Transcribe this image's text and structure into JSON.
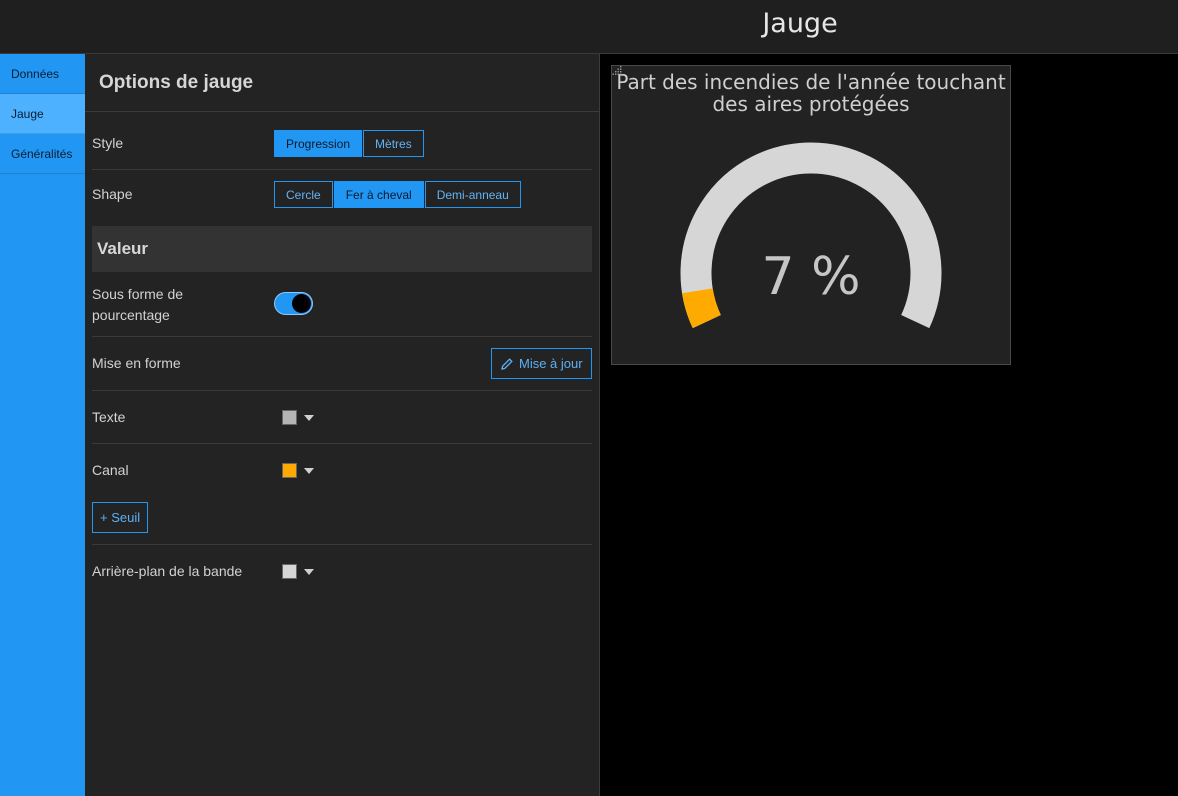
{
  "header": {
    "title": "Jauge"
  },
  "nav": {
    "items": [
      {
        "label": "Données",
        "active": false
      },
      {
        "label": "Jauge",
        "active": true
      },
      {
        "label": "Généralités",
        "active": false
      }
    ]
  },
  "panel": {
    "title": "Options de jauge",
    "style": {
      "label": "Style",
      "options": [
        "Progression",
        "Mètres"
      ],
      "selected": "Progression"
    },
    "shape": {
      "label": "Shape",
      "options": [
        "Cercle",
        "Fer à cheval",
        "Demi-anneau"
      ],
      "selected": "Fer à cheval"
    },
    "section_value": "Valeur",
    "percent": {
      "label_line1": "Sous forme de",
      "label_line2": "pourcentage",
      "on": true
    },
    "format": {
      "label": "Mise en forme",
      "button": "Mise à jour"
    },
    "text": {
      "label": "Texte",
      "color": "#b5b5b5"
    },
    "channel": {
      "label": "Canal",
      "color": "#ffaa00"
    },
    "threshold_button": "+ Seuil",
    "band_bg": {
      "label": "Arrière-plan de la bande",
      "color": "#d6d6d6"
    }
  },
  "gauge": {
    "title_line1": "Part des incendies de l'année touchant",
    "title_line2": "des aires protégées",
    "value_text": "7 %",
    "value": 7,
    "min": 0,
    "max": 100,
    "fill_color": "#ffaa00",
    "track_color": "#d6d6d6"
  }
}
